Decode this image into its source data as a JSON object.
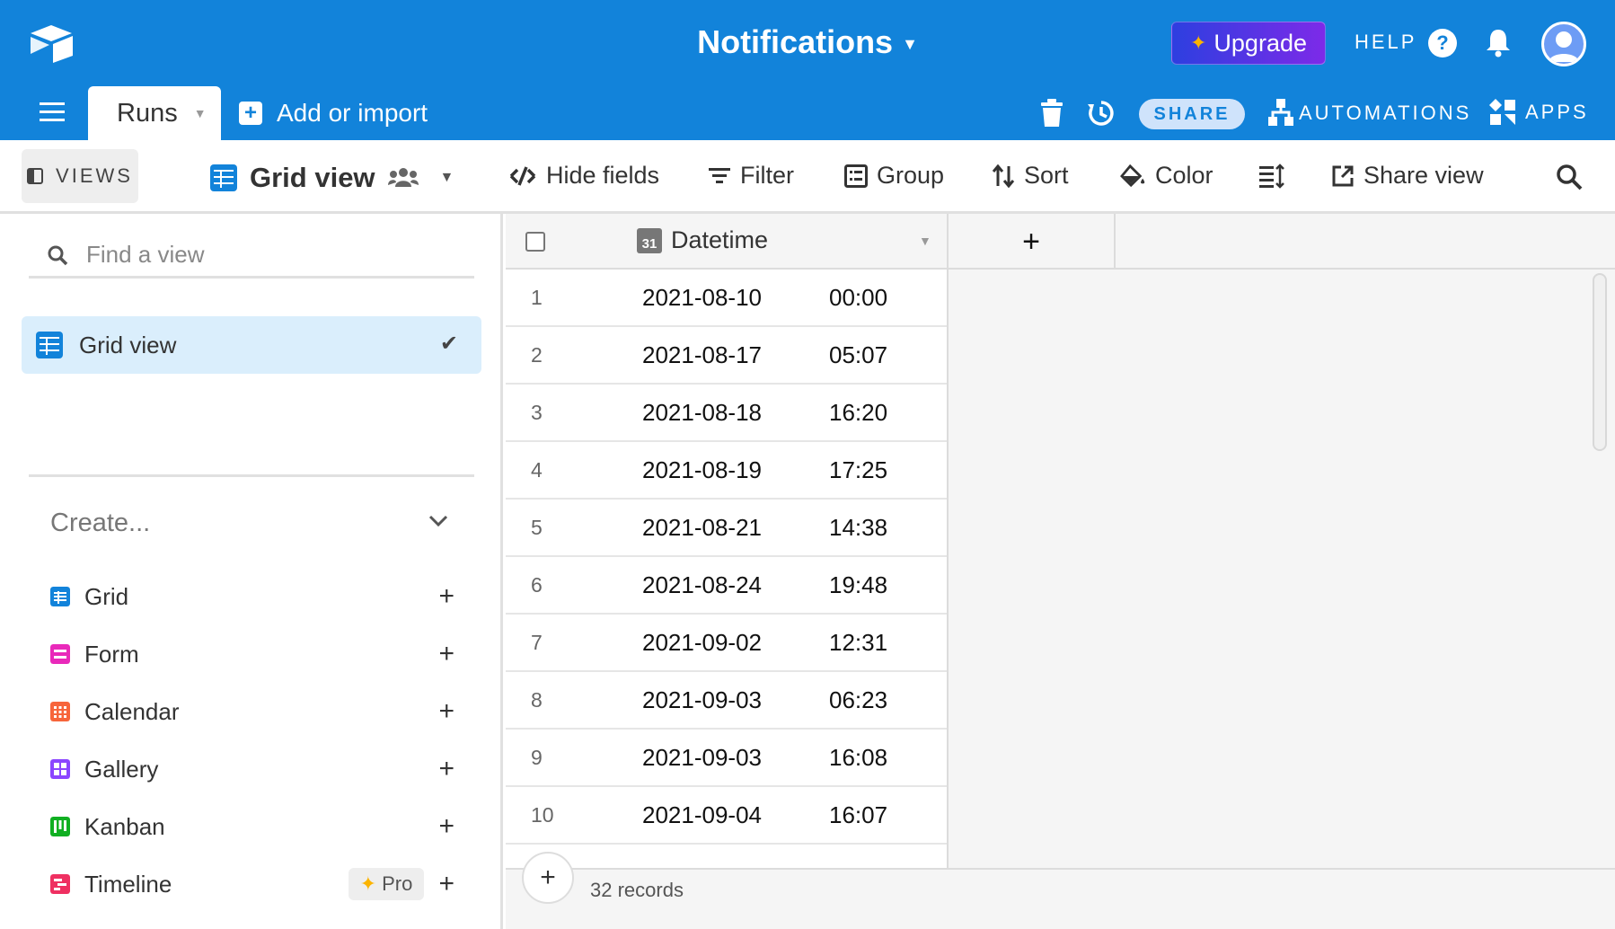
{
  "header": {
    "title": "Notifications",
    "upgrade_label": "Upgrade",
    "help_label": "HELP",
    "help_icon_text": "?",
    "brand_color": "#1283da"
  },
  "tabs": {
    "active": "Runs",
    "add_label": "Add or import",
    "share_label": "SHARE",
    "automations_label": "AUTOMATIONS",
    "apps_label": "APPS"
  },
  "toolbar": {
    "views_label": "VIEWS",
    "view_name": "Grid view",
    "hide_fields": "Hide fields",
    "filter": "Filter",
    "group": "Group",
    "sort": "Sort",
    "color": "Color",
    "share_view": "Share view"
  },
  "sidebar": {
    "find_placeholder": "Find a view",
    "views": [
      {
        "label": "Grid view",
        "selected": true
      }
    ],
    "create_label": "Create...",
    "create_items": [
      {
        "label": "Grid",
        "color": "#1283da",
        "icon": "grid-icon"
      },
      {
        "label": "Form",
        "color": "#e929ba",
        "icon": "form-icon"
      },
      {
        "label": "Calendar",
        "color": "#f7653b",
        "icon": "calendar-icon"
      },
      {
        "label": "Gallery",
        "color": "#8b46ff",
        "icon": "gallery-icon"
      },
      {
        "label": "Kanban",
        "color": "#11af22",
        "icon": "kanban-icon"
      },
      {
        "label": "Timeline",
        "color": "#ef3061",
        "icon": "timeline-icon",
        "badge": "Pro"
      }
    ]
  },
  "grid": {
    "field_name": "Datetime",
    "calendar_icon_text": "31",
    "rows": [
      {
        "num": "1",
        "date": "2021-08-10",
        "time": "00:00"
      },
      {
        "num": "2",
        "date": "2021-08-17",
        "time": "05:07"
      },
      {
        "num": "3",
        "date": "2021-08-18",
        "time": "16:20"
      },
      {
        "num": "4",
        "date": "2021-08-19",
        "time": "17:25"
      },
      {
        "num": "5",
        "date": "2021-08-21",
        "time": "14:38"
      },
      {
        "num": "6",
        "date": "2021-08-24",
        "time": "19:48"
      },
      {
        "num": "7",
        "date": "2021-09-02",
        "time": "12:31"
      },
      {
        "num": "8",
        "date": "2021-09-03",
        "time": "06:23"
      },
      {
        "num": "9",
        "date": "2021-09-03",
        "time": "16:08"
      },
      {
        "num": "10",
        "date": "2021-09-04",
        "time": "16:07"
      }
    ],
    "record_count": "32 records"
  }
}
